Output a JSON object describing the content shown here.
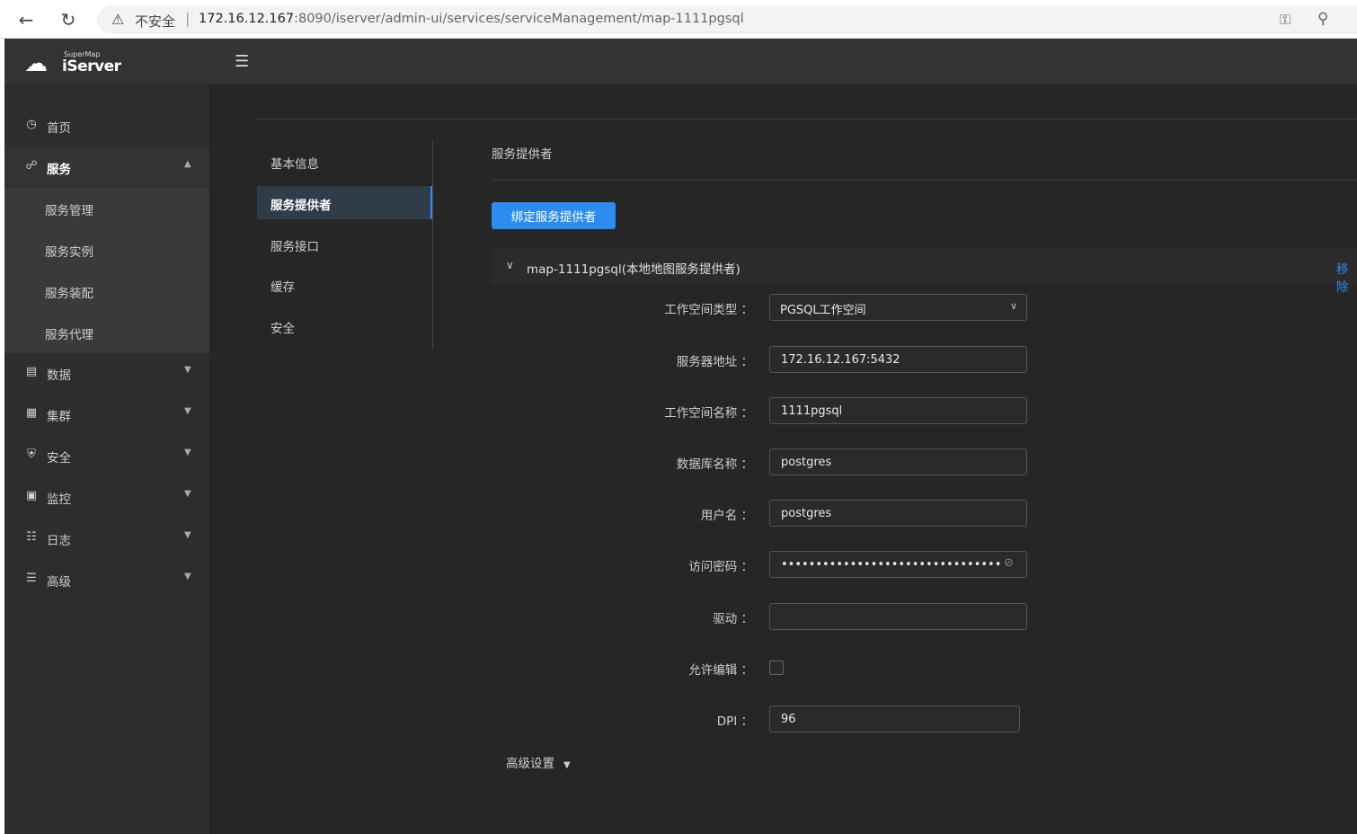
{
  "browser": {
    "insecure_label": "不安全",
    "url_host": "172.16.12.167",
    "url_rest": ":8090/iserver/admin-ui/services/serviceManagement/map-1111pgsql"
  },
  "app": {
    "brand_small": "SuperMap",
    "brand": "iServer"
  },
  "sidebar": {
    "items": [
      {
        "label": "首页",
        "icon": "dashboard-icon"
      },
      {
        "label": "服务",
        "icon": "service-icon"
      },
      {
        "label": "数据",
        "icon": "database-icon"
      },
      {
        "label": "集群",
        "icon": "cluster-icon"
      },
      {
        "label": "安全",
        "icon": "shield-icon"
      },
      {
        "label": "监控",
        "icon": "monitor-icon"
      },
      {
        "label": "日志",
        "icon": "log-icon"
      },
      {
        "label": "高级",
        "icon": "sliders-icon"
      }
    ],
    "service_sub": [
      "服务管理",
      "服务实例",
      "服务装配",
      "服务代理"
    ]
  },
  "tabs": [
    "基本信息",
    "服务提供者",
    "服务接口",
    "缓存",
    "安全"
  ],
  "section": {
    "title": "服务提供者",
    "bind_button": "绑定服务提供者"
  },
  "provider": {
    "name": "map-1111pgsql(本地地图服务提供者)",
    "remove": "移除"
  },
  "form": {
    "workspace_type_label": "工作空间类型 ：",
    "workspace_type_value": "PGSQL工作空间",
    "server_label": "服务器地址 ：",
    "server_value": "172.16.12.167:5432",
    "workspace_name_label": "工作空间名称 ：",
    "workspace_name_value": "1111pgsql",
    "db_name_label": "数据库名称 ：",
    "db_name_value": "postgres",
    "user_label": "用户名 ：",
    "user_value": "postgres",
    "password_label": "访问密码 ：",
    "password_value": "••••••••••••••••••••••••••••••••",
    "driver_label": "驱动 ：",
    "driver_value": "",
    "editable_label": "允许编辑 ：",
    "dpi_label": "DPI ：",
    "dpi_value": "96"
  },
  "advanced_label": "高级设置"
}
